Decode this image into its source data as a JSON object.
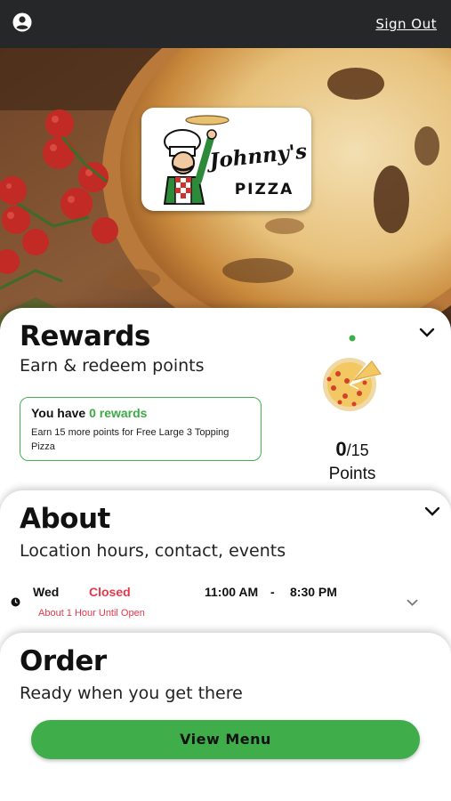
{
  "header": {
    "sign_out_label": "Sign Out"
  },
  "brand": {
    "logo_text_line1": "Johnny's",
    "logo_text_line2": "PIZZA"
  },
  "rewards": {
    "title": "Rewards",
    "subtitle": "Earn & redeem points",
    "have_prefix": "You have",
    "rewards_count": "0 rewards",
    "earn_text": "Earn 15 more points for Free Large 3 Topping Pizza",
    "points_current": "0",
    "points_total": "/15",
    "points_label": "Points",
    "progress_fraction": 0
  },
  "about": {
    "title": "About",
    "subtitle": "Location hours, contact, events",
    "day": "Wed",
    "status": "Closed",
    "open_time": "11:00 AM",
    "separator": "-",
    "close_time": "8:30 PM",
    "until_text": "About 1 Hour Until Open"
  },
  "order": {
    "title": "Order",
    "subtitle": "Ready when you get there",
    "view_menu_label": "View Menu"
  },
  "colors": {
    "accent_green": "#3fae4a",
    "closed_red": "#e6384a",
    "topbar": "#262729"
  }
}
